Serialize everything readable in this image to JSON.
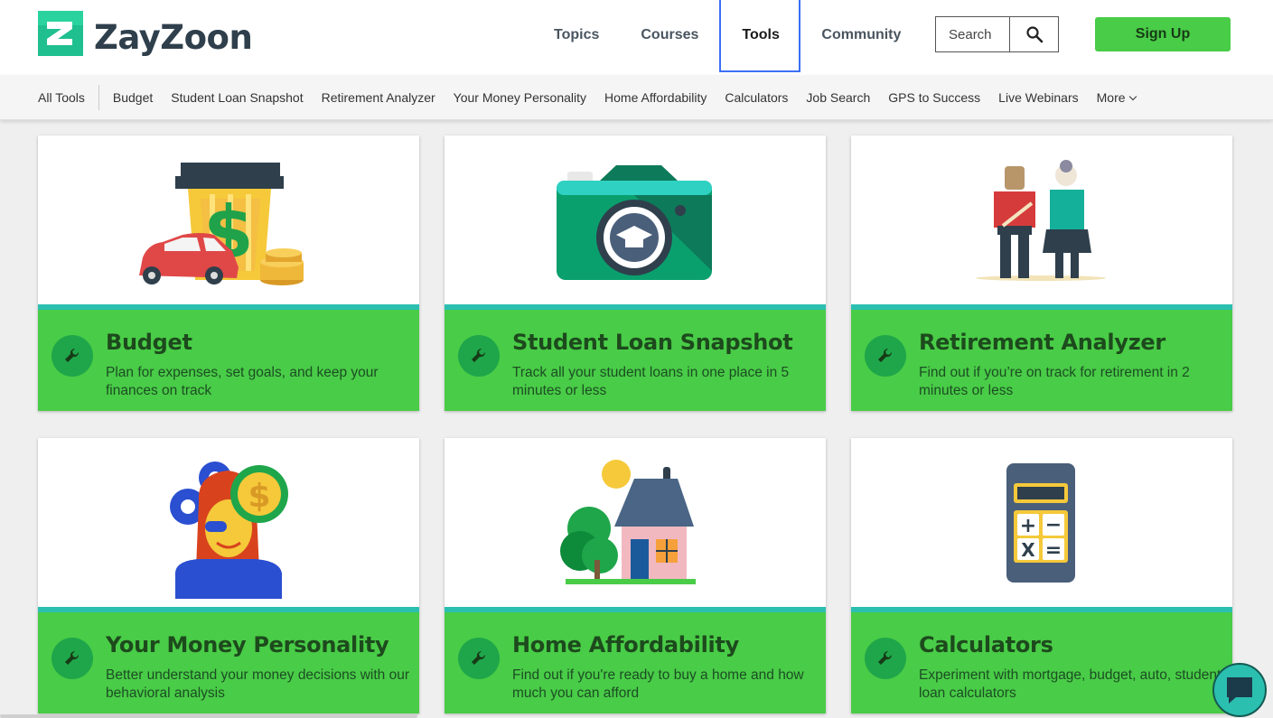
{
  "brand": {
    "name": "ZayZoon",
    "mark_letter": "Z",
    "color": "#1fbf8f"
  },
  "nav": {
    "items": [
      {
        "label": "Topics",
        "active": false
      },
      {
        "label": "Courses",
        "active": false
      },
      {
        "label": "Tools",
        "active": true
      },
      {
        "label": "Community",
        "active": false
      }
    ]
  },
  "search": {
    "placeholder": "Search",
    "icon": "search-icon"
  },
  "signup": {
    "label": "Sign Up",
    "color": "#49cc47"
  },
  "subnav": {
    "items": [
      "All Tools",
      "Budget",
      "Student Loan Snapshot",
      "Retirement Analyzer",
      "Your Money Personality",
      "Home Affordability",
      "Calculators",
      "Job Search",
      "GPS to Success",
      "Live Webinars"
    ],
    "more_label": "More"
  },
  "cards": [
    {
      "title": "Budget",
      "desc": "Plan for expenses, set goals, and keep your finances on track",
      "illustration": "budget-illustration"
    },
    {
      "title": "Student Loan Snapshot",
      "desc": "Track all your student loans in one place in 5 minutes or less",
      "illustration": "camera-illustration"
    },
    {
      "title": "Retirement Analyzer",
      "desc": "Find out if you’re on track for retirement in 2 minutes or less",
      "illustration": "retirees-illustration"
    },
    {
      "title": "Your Money Personality",
      "desc": "Better understand your money decisions with our behavioral analysis",
      "illustration": "personality-illustration"
    },
    {
      "title": "Home Affordability",
      "desc": "Find out if you're ready to buy a home and how much you can afford",
      "illustration": "house-illustration"
    },
    {
      "title": "Calculators",
      "desc": "Experiment with mortgage, budget, auto, student loan calculators",
      "illustration": "calculator-illustration"
    }
  ],
  "colors": {
    "card_body": "#49cc47",
    "stripe": "#2bbfb0",
    "wrench_circle": "#1fa64a"
  }
}
